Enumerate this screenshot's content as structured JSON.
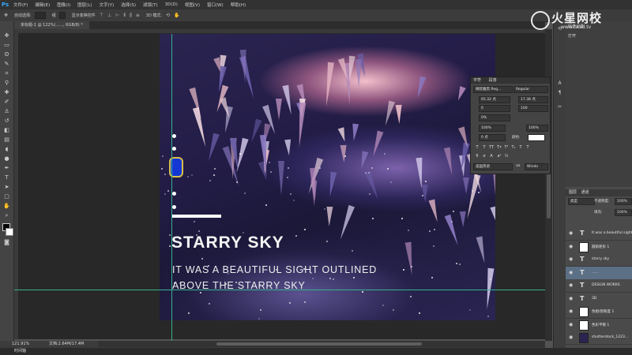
{
  "app": {
    "logo": "Ps"
  },
  "menu": [
    "文件(F)",
    "编辑(E)",
    "图像(I)",
    "图层(L)",
    "文字(Y)",
    "选择(S)",
    "滤镜(T)",
    "3D(D)",
    "视图(V)",
    "窗口(W)",
    "帮助(H)"
  ],
  "options_bar": {
    "auto_select": "自动选择:",
    "auto_select_value": "组",
    "show_transform": "显示变换控件",
    "mode_3d": "3D 模式:"
  },
  "document_tab": "未标题-1 @ 122%(......, RGB/8) *",
  "canvas": {
    "headline": "STARRY SKY",
    "sub_line1": "IT WAS A BEAUTIFUL SIGHT OUTLINED",
    "sub_line2": "ABOVE THE STARRY SKY"
  },
  "character_panel": {
    "tabs": [
      "字符",
      "段落"
    ],
    "font_family": "微软雅黑 Reg...",
    "font_style": "Regular",
    "font_size": "65.32 点",
    "leading": "17.38 点",
    "kerning": "0",
    "tracking": "100",
    "scale_pct": "0%",
    "vscale": "100%",
    "hscale": "100%",
    "baseline": "0 点",
    "color_label": "颜色:",
    "language": "美国英语",
    "aa_icon": "aa",
    "aa_mode": "Windo"
  },
  "right_panels": {
    "history_title": "历史记录",
    "history_item": "打开",
    "layers_tabs": [
      "图层",
      "通道"
    ],
    "kind": "类型",
    "opacity_label": "不透明度:",
    "opacity": "100%",
    "fill_label": "填充:",
    "fill": "100%"
  },
  "layers": [
    {
      "name": "It was a beautiful sight",
      "type": "text",
      "selected": false
    },
    {
      "name": "圆角矩形 1",
      "type": "shape",
      "selected": false
    },
    {
      "name": "starry sky",
      "type": "text",
      "selected": false
    },
    {
      "name": "......",
      "type": "text",
      "selected": true
    },
    {
      "name": "DESIGN WORKS",
      "type": "text",
      "selected": false
    },
    {
      "name": "3D",
      "type": "text",
      "selected": false
    },
    {
      "name": "色相/饱和度 1",
      "type": "adjust",
      "selected": false
    },
    {
      "name": "色彩平衡 1",
      "type": "adjust",
      "selected": false
    },
    {
      "name": "shutterstock_1223...",
      "type": "image",
      "selected": false
    }
  ],
  "status": {
    "zoom": "121.91%",
    "doc": "文档:2.64M/17.4M",
    "footer": "时间轴"
  },
  "watermark": {
    "brand": "火星网校",
    "url": "www.hxsd.tv"
  },
  "colors": {
    "accent": "#38b08c",
    "selected_layer": "#5b6f85",
    "ui_dark": "#282828"
  }
}
